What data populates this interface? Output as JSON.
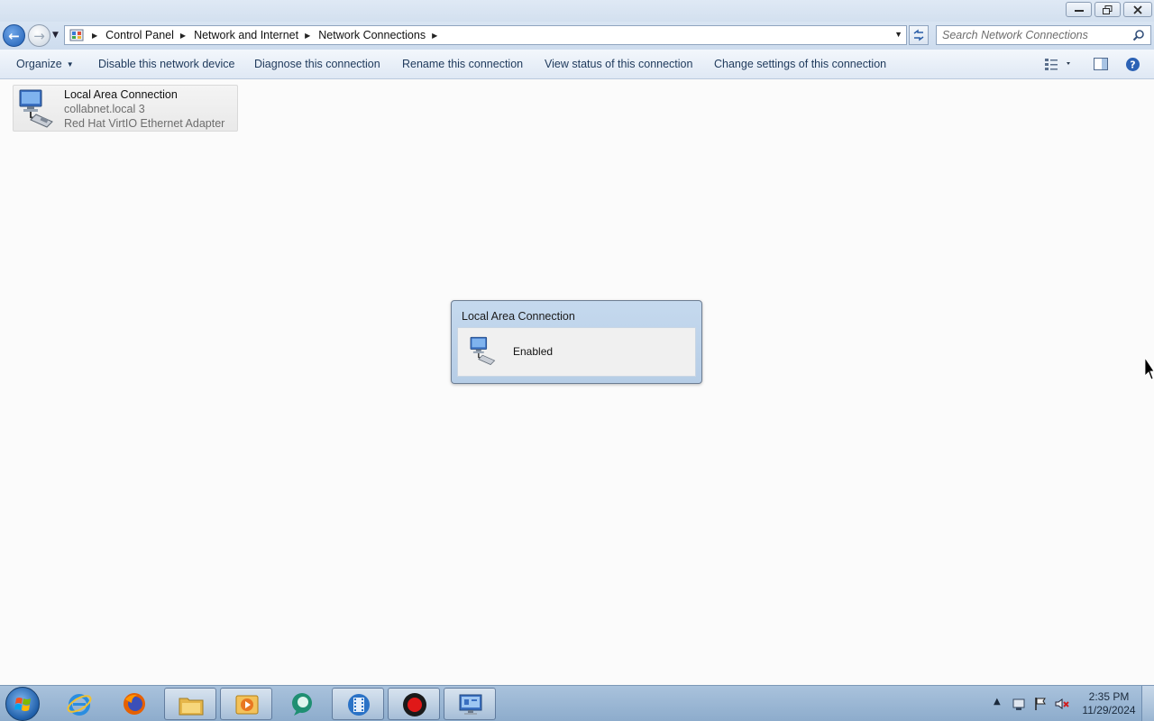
{
  "window": {
    "controls": {
      "minimize_icon": "minimize-icon",
      "maximize_icon": "restore-icon",
      "close_icon": "close-icon"
    }
  },
  "navigation": {
    "back_icon": "back-arrow-icon",
    "forward_icon": "forward-arrow-icon",
    "breadcrumb": [
      "Control Panel",
      "Network and Internet",
      "Network Connections"
    ],
    "search": {
      "placeholder": "Search Network Connections",
      "value": ""
    }
  },
  "toolbar": {
    "organize": "Organize",
    "disable": "Disable this network device",
    "diagnose": "Diagnose this connection",
    "rename": "Rename this connection",
    "view_status": "View status of this connection",
    "change_settings": "Change settings of this connection"
  },
  "connections": [
    {
      "name": "Local Area Connection",
      "network": "collabnet.local  3",
      "adapter": "Red Hat VirtIO Ethernet Adapter",
      "icon": "network-adapter-icon"
    }
  ],
  "popup": {
    "title": "Local Area Connection",
    "status": "Enabled",
    "icon": "network-adapter-icon"
  },
  "taskbar": {
    "apps": [
      {
        "name": "internet-explorer",
        "active": false
      },
      {
        "name": "firefox",
        "active": false
      },
      {
        "name": "file-explorer",
        "active": true
      },
      {
        "name": "media-player",
        "active": true
      },
      {
        "name": "chat-app",
        "active": false
      },
      {
        "name": "video-editor",
        "active": true
      },
      {
        "name": "screen-recorder",
        "active": true
      },
      {
        "name": "control-panel",
        "active": true
      }
    ],
    "clock": {
      "time": "2:35 PM",
      "date": "11/29/2024"
    }
  },
  "colors": {
    "accent": "#1e395b",
    "taskbar": "#9bb7d4",
    "popup_header": "#c5d9ee"
  }
}
